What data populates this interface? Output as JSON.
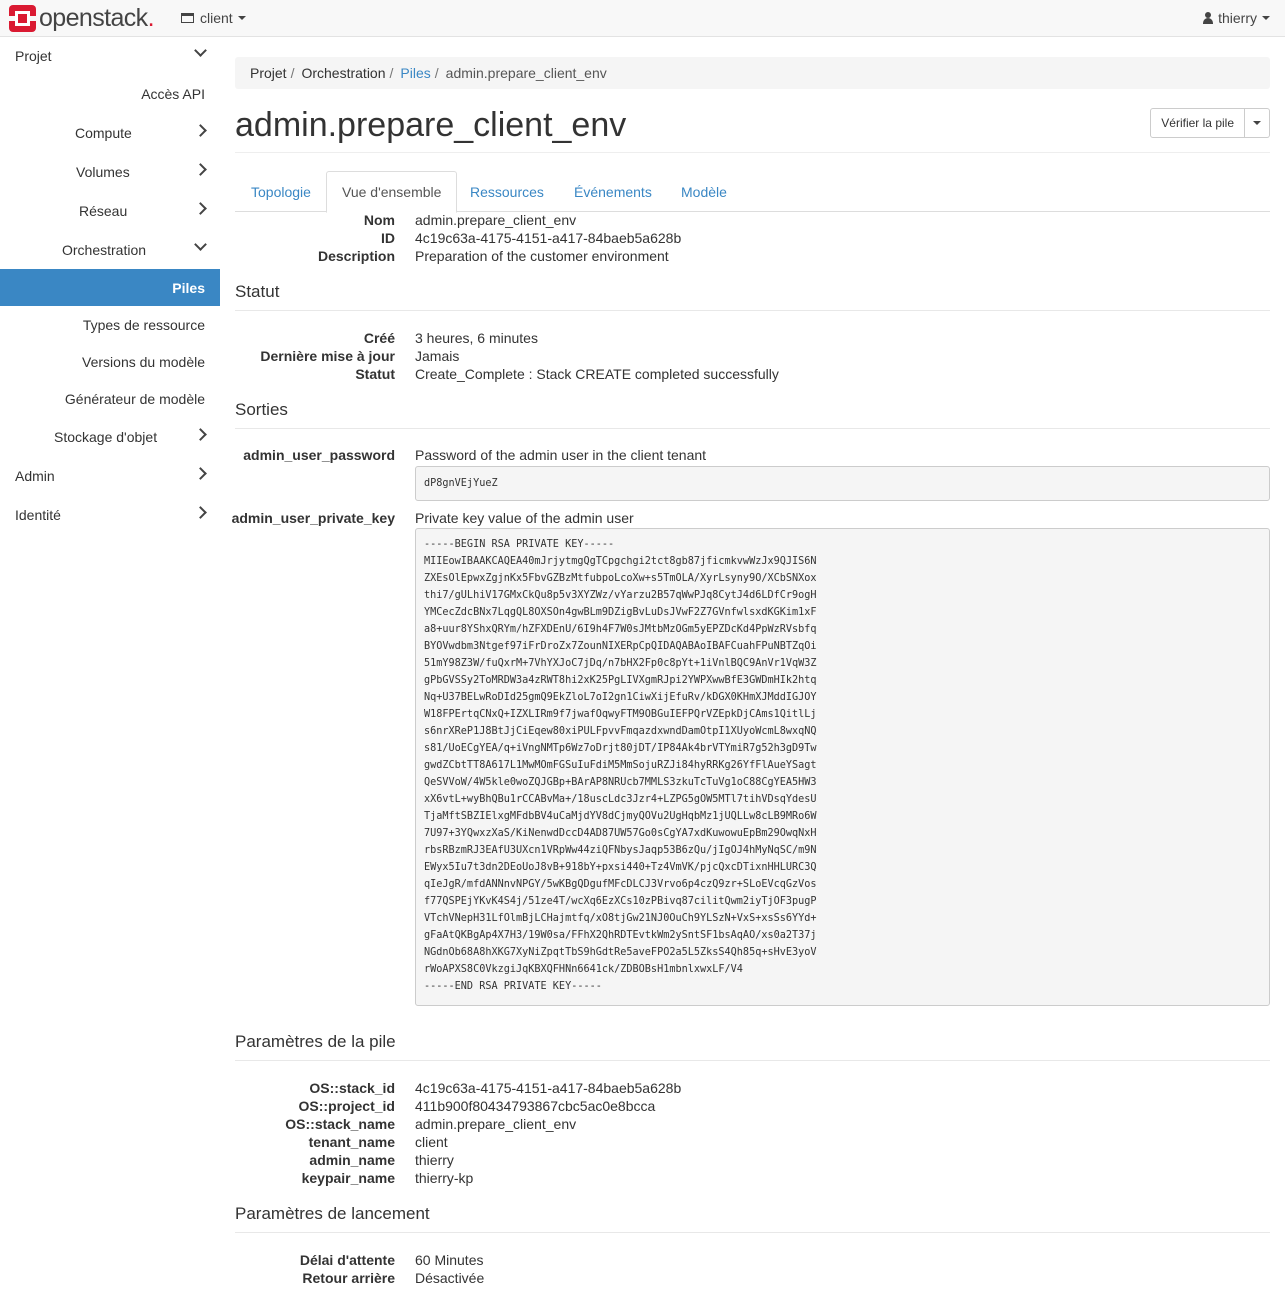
{
  "topbar": {
    "brand": "openstack",
    "project": "client",
    "user": "thierry"
  },
  "sidebar": {
    "items": [
      {
        "label": "Projet"
      },
      {
        "label": "Accès API"
      },
      {
        "label": "Compute"
      },
      {
        "label": "Volumes"
      },
      {
        "label": "Réseau"
      },
      {
        "label": "Orchestration"
      },
      {
        "label": "Piles"
      },
      {
        "label": "Types de ressource"
      },
      {
        "label": "Versions du modèle"
      },
      {
        "label": "Générateur de modèle"
      },
      {
        "label": "Stockage d'objet"
      },
      {
        "label": "Admin"
      },
      {
        "label": "Identité"
      }
    ]
  },
  "breadcrumb": {
    "items": [
      "Projet",
      "Orchestration",
      "Piles",
      "admin.prepare_client_env"
    ]
  },
  "page": {
    "title": "admin.prepare_client_env",
    "action_button": "Vérifier la pile"
  },
  "tabs": [
    "Topologie",
    "Vue d'ensemble",
    "Ressources",
    "Événements",
    "Modèle"
  ],
  "overview": {
    "rows": [
      {
        "label": "Nom",
        "value": "admin.prepare_client_env"
      },
      {
        "label": "ID",
        "value": "4c19c63a-4175-4151-a417-84baeb5a628b"
      },
      {
        "label": "Description",
        "value": "Preparation of the customer environment"
      }
    ]
  },
  "status": {
    "heading": "Statut",
    "rows": [
      {
        "label": "Créé",
        "value": "3 heures, 6 minutes"
      },
      {
        "label": "Dernière mise à jour",
        "value": "Jamais"
      },
      {
        "label": "Statut",
        "value": "Create_Complete : Stack CREATE completed successfully"
      }
    ]
  },
  "outputs": {
    "heading": "Sorties",
    "items": [
      {
        "label": "admin_user_password",
        "description": "Password of the admin user in the client tenant",
        "value": "dP8gnVEjYueZ"
      },
      {
        "label": "admin_user_private_key",
        "description": "Private key value of the admin user",
        "value": "-----BEGIN RSA PRIVATE KEY-----\nMIIEowIBAAKCAQEA40mJrjytmgQgTCpgchgi2tct8gb87jficmkvwWzJx9QJIS6N\nZXEsOlEpwxZgjnKx5FbvGZBzMtfubpoLcoXw+s5TmOLA/XyrLsyny9O/XCbSNXox\nthi7/gULhiV17GMxCkQu8p5v3XYZWz/vYarzu2B57qWwPJq8CytJ4d6LDfCr9ogH\nYMCecZdcBNx7LqgQL8OXSOn4gwBLm9DZigBvLuDsJVwF2Z7GVnfwlsxdKGKim1xF\na8+uur8YShxQRYm/hZFXDEnU/6I9h4F7W0sJMtbMzOGm5yEPZDcKd4PpWzRVsbfq\nBYOVwdbm3Ntgef97iFrDroZx7ZounNIXERpCpQIDAQABAoIBAFCuahFPuNBTZqOi\n51mY98Z3W/fuQxrM+7VhYXJoC7jDq/n7bHX2Fp0c8pYt+1iVnlBQC9AnVr1VqW3Z\ngPbGVSSy2ToMRDW3a4zRWT8hi2xK25PgLIVXgmRJpi2YWPXwwBfE3GWDmHIk2htq\nNq+U37BELwRoDId25gmQ9EkZloL7oI2gn1CiwXijEfuRv/kDGX0KHmXJMddIGJOY\nW18FPErtqCNxQ+IZXLIRm9f7jwafOqwyFTM9OBGuIEFPQrVZEpkDjCAms1QitlLj\ns6nrXReP1J8BtJjCiEqew80xiPULFpvvFmqazdxwndDamOtpI1XUyoWcmL8wxqNQ\ns81/UoECgYEA/q+iVngNMTp6Wz7oDrjt80jDT/IP84Ak4brVTYmiR7g52h3gD9Tw\ngwdZCbtTT8A617L1MwMOmFGSuIuFdiM5MmSojuRZJi84hyRRKg26YfFlAueYSagt\nQeSVVoW/4W5kle0woZQJGBp+BArAP8NRUcb7MMLS3zkuTcTuVg1oC88CgYEA5HW3\nxX6vtL+wyBhQBu1rCCABvMa+/18uscLdc3Jzr4+LZPG5gOW5MTl7tihVDsqYdesU\nTjaMftSBZIElxgMFdbBV4uCaMjdYV8dCjmyQOVu2UgHqbMz1jUQLLw8cLB9MRo6W\n7U97+3YQwxzXaS/KiNenwdDccD4AD87UW57Go0sCgYA7xdKuwowuEpBm29OwqNxH\nrbsRBzmRJ3EAfU3UXcn1VRpWw44ziQFNbysJaqp53B6zQu/jIgOJ4hMyNqSC/m9N\nEWyx5Iu7t3dn2DEoUoJ8vB+918bY+pxsi440+Tz4VmVK/pjcQxcDTixnHHLURC3Q\nqIeJgR/mfdANNnvNPGY/5wKBgQDgufMFcDLCJ3Vrvo6p4czQ9zr+SLoEVcqGzVos\nf77QSPEjYKvK4S4j/51ze4T/wcXq6EzXCs10zPBivq87cilitQwm2iyTjOF3pugP\nVTchVNepH31LfOlmBjLCHajmtfq/xO8tjGw21NJ0OuCh9YLSzN+VxS+xsSs6YYd+\ngFaAtQKBgAp4X7H3/19W0sa/FFhX2QhRDTEvtkWm2ySntSF1bsAqAO/xs0a2T37j\nNGdnOb68A8hXKG7XyNiZpqtTbS9hGdtRe5aveFPO2a5L5ZksS4Qh85q+sHvE3yoV\nrWoAPXS8C0VkzgiJqKBXQFHNn6641ck/ZDBOBsH1mbnlxwxLF/V4\n-----END RSA PRIVATE KEY-----"
      }
    ]
  },
  "stack_params": {
    "heading": "Paramètres de la pile",
    "rows": [
      {
        "label": "OS::stack_id",
        "value": "4c19c63a-4175-4151-a417-84baeb5a628b"
      },
      {
        "label": "OS::project_id",
        "value": "411b900f80434793867cbc5ac0e8bcca"
      },
      {
        "label": "OS::stack_name",
        "value": "admin.prepare_client_env"
      },
      {
        "label": "tenant_name",
        "value": "client"
      },
      {
        "label": "admin_name",
        "value": "thierry"
      },
      {
        "label": "keypair_name",
        "value": "thierry-kp"
      }
    ]
  },
  "launch_params": {
    "heading": "Paramètres de lancement",
    "rows": [
      {
        "label": "Délai d'attente",
        "value": "60 Minutes"
      },
      {
        "label": "Retour arrière",
        "value": "Désactivée"
      }
    ]
  },
  "colors": {
    "accent": "#3a87c4",
    "brand_red": "#da1a32"
  }
}
